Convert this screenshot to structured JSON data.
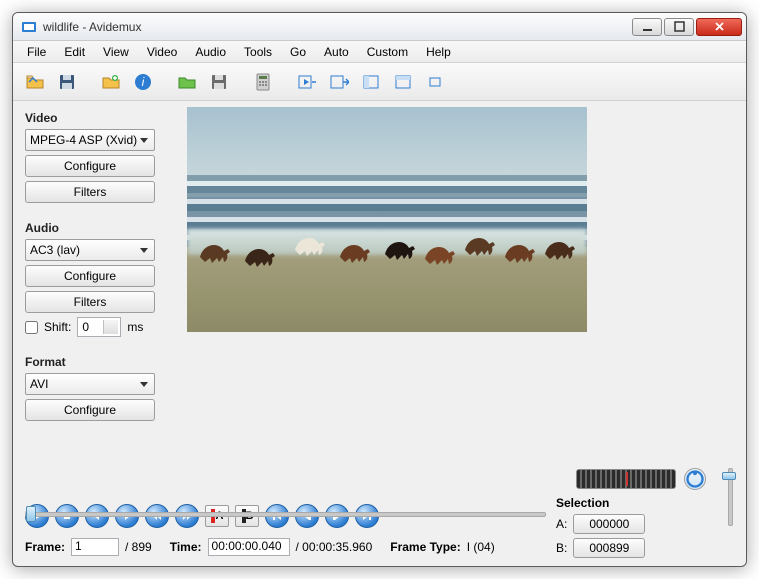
{
  "window": {
    "title": "wildlife - Avidemux"
  },
  "menu": {
    "items": [
      "File",
      "Edit",
      "View",
      "Video",
      "Audio",
      "Tools",
      "Go",
      "Auto",
      "Custom",
      "Help"
    ]
  },
  "toolbar": {
    "icons": [
      "open",
      "save",
      "open-alt",
      "info",
      "open-folder",
      "save-alt",
      "calculator",
      "play-out",
      "next-out",
      "col-a",
      "col-b",
      "window-small"
    ]
  },
  "video": {
    "label": "Video",
    "codec": "MPEG-4 ASP (Xvid)",
    "configure": "Configure",
    "filters": "Filters"
  },
  "audio": {
    "label": "Audio",
    "codec": "AC3 (lav)",
    "configure": "Configure",
    "filters": "Filters",
    "shift_label": "Shift:",
    "shift_value": "0",
    "shift_unit": "ms"
  },
  "format": {
    "label": "Format",
    "container": "AVI",
    "configure": "Configure"
  },
  "selection": {
    "label": "Selection",
    "a_label": "A:",
    "a_value": "000000",
    "b_label": "B:",
    "b_value": "000899"
  },
  "info": {
    "frame_label": "Frame:",
    "frame_value": "1",
    "frame_total": "/ 899",
    "time_label": "Time:",
    "time_value": "00:00:00.040",
    "time_total": "/ 00:00:35.960",
    "frametype_label": "Frame Type:",
    "frametype_value": "I (04)"
  }
}
